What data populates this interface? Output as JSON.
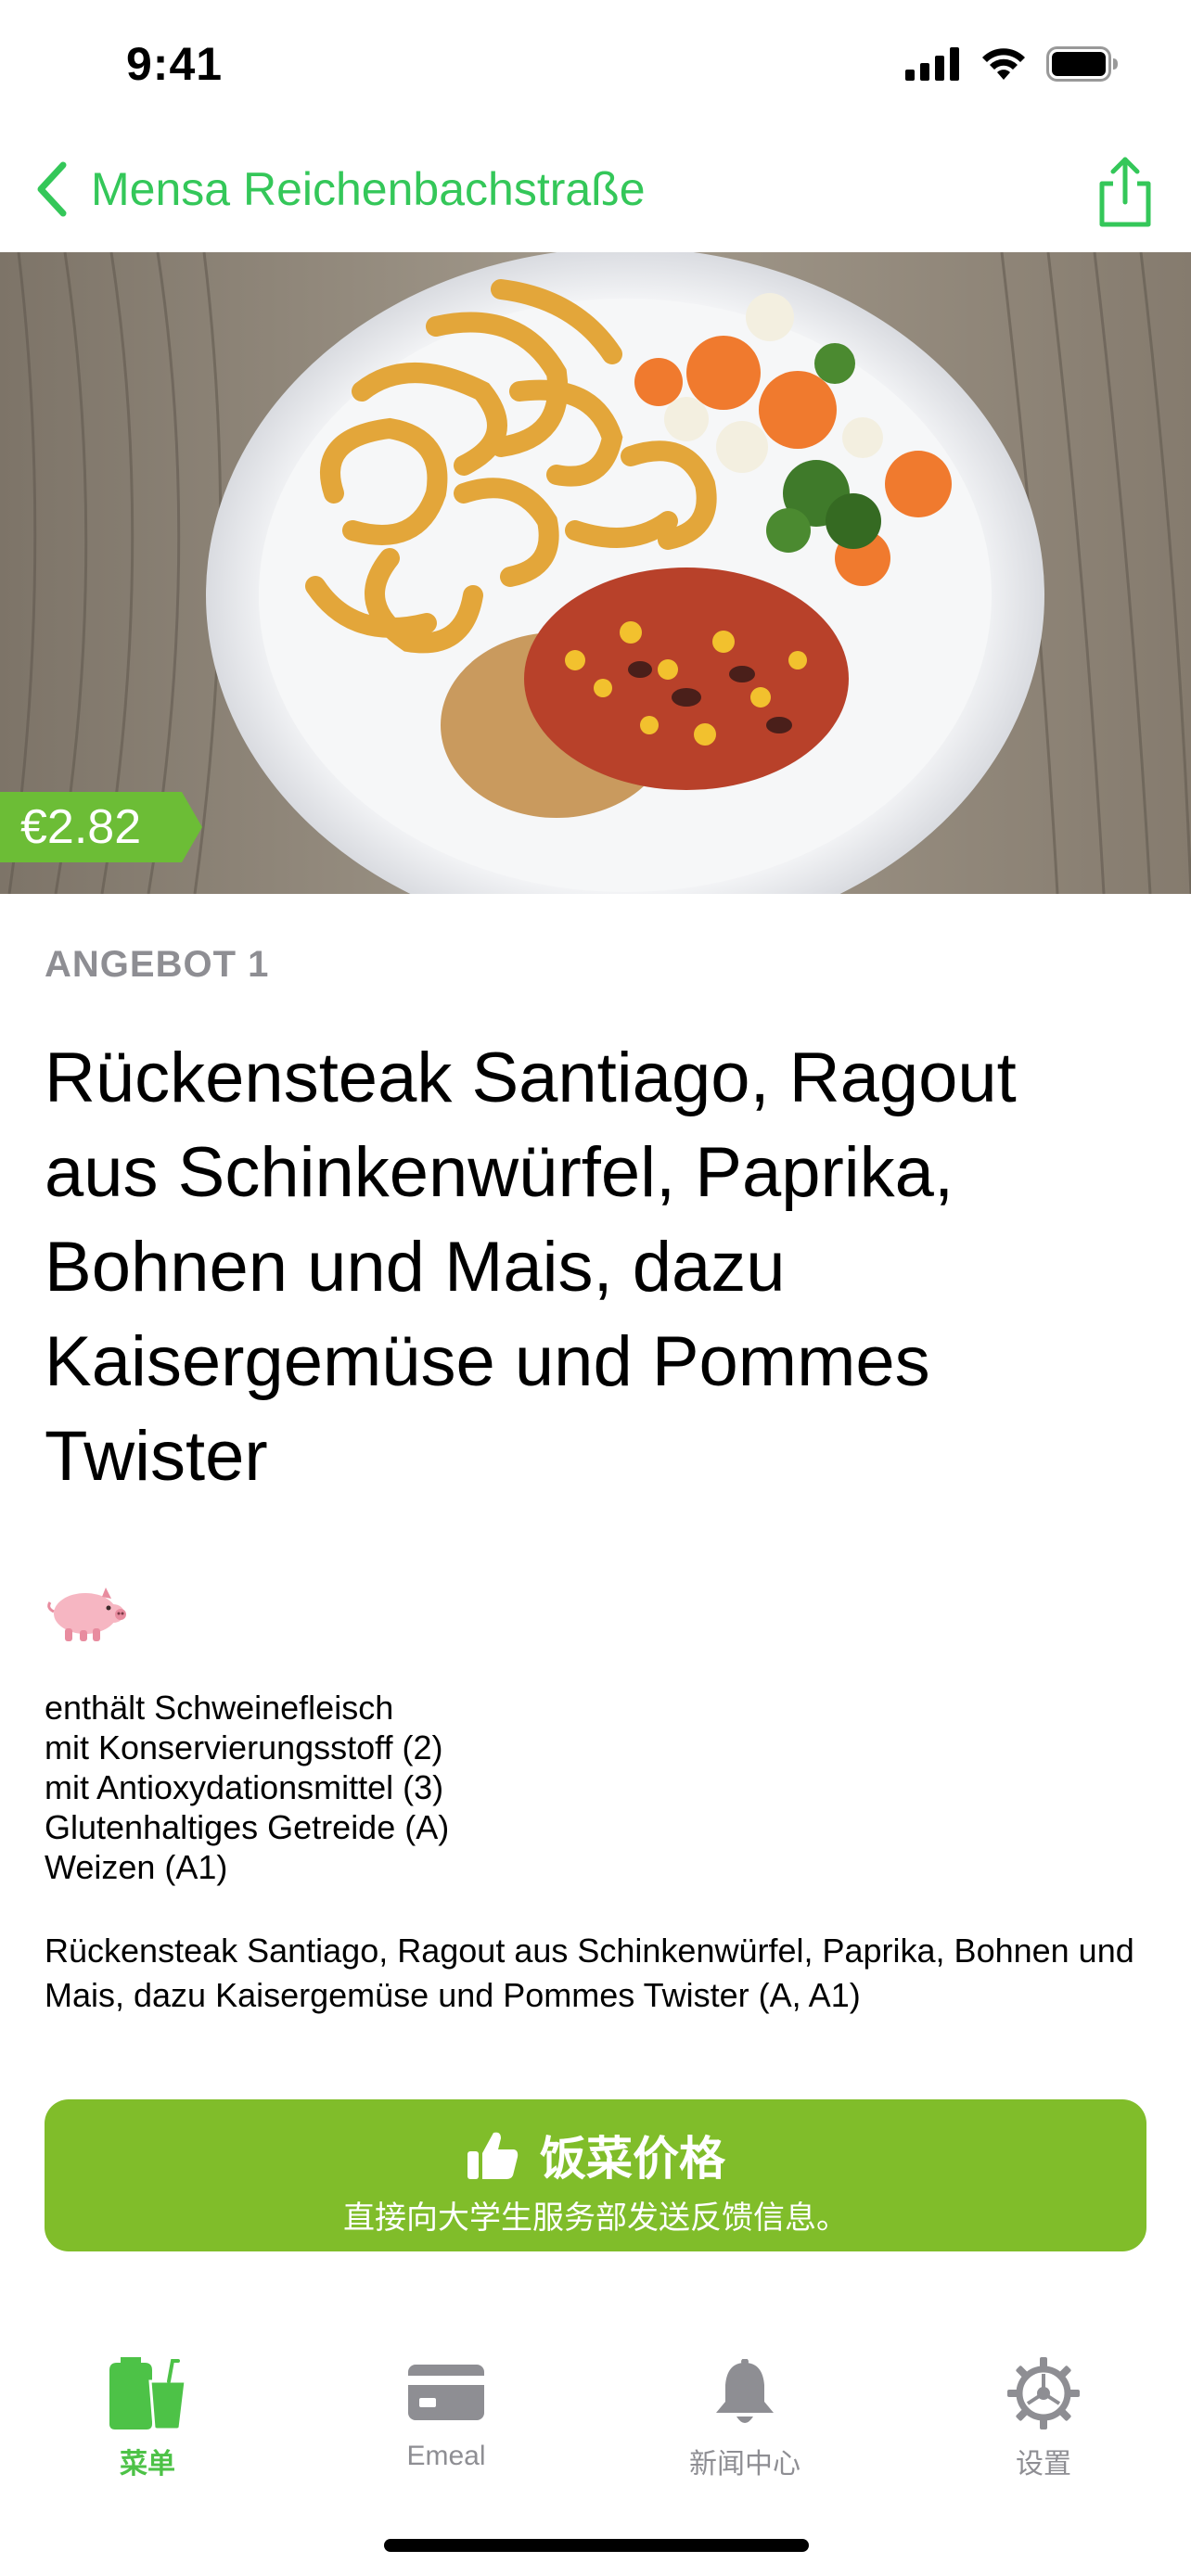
{
  "status_bar": {
    "time": "9:41",
    "icons": [
      "cellular-signal-icon",
      "wifi-icon",
      "battery-icon"
    ]
  },
  "nav": {
    "back_label": "Mensa Reichenbachstraße",
    "back_icon": "chevron-left-icon",
    "share_icon": "share-icon",
    "accent_color": "#34c759"
  },
  "hero": {
    "image": "plate-with-curly-fries-steak-ragout-vegetables",
    "price": "€2.82",
    "price_badge_color": "#6cbd36"
  },
  "meal": {
    "section_label": "ANGEBOT 1",
    "title": "Rückensteak Santiago, Ragout aus Schinkenwürfel, Paprika, Bohnen und Mais, dazu Kaisergemüse und Pommes Twister",
    "diet_icon": "pig-icon",
    "allergens": [
      "enthält Schweinefleisch",
      "mit Konservierungsstoff (2)",
      "mit Antioxydationsmittel (3)",
      "Glutenhaltiges Getreide (A)",
      "Weizen (A1)"
    ],
    "description": "Rückensteak Santiago, Ragout aus Schinkenwürfel, Paprika, Bohnen und Mais, dazu Kaisergemüse und Pommes Twister (A, A1)"
  },
  "rate_button": {
    "icon": "thumbs-up-icon",
    "title": "饭菜价格",
    "subtitle": "直接向大学生服务部发送反馈信息。",
    "color": "#80bd2a"
  },
  "tab_bar": {
    "tabs": [
      {
        "label": "菜单",
        "icon": "food-icon",
        "active": true
      },
      {
        "label": "Emeal",
        "icon": "card-icon",
        "active": false
      },
      {
        "label": "新闻中心",
        "icon": "bell-icon",
        "active": false
      },
      {
        "label": "设置",
        "icon": "gear-icon",
        "active": false
      }
    ],
    "active_color": "#4dc247",
    "inactive_color": "#8e8e93"
  }
}
